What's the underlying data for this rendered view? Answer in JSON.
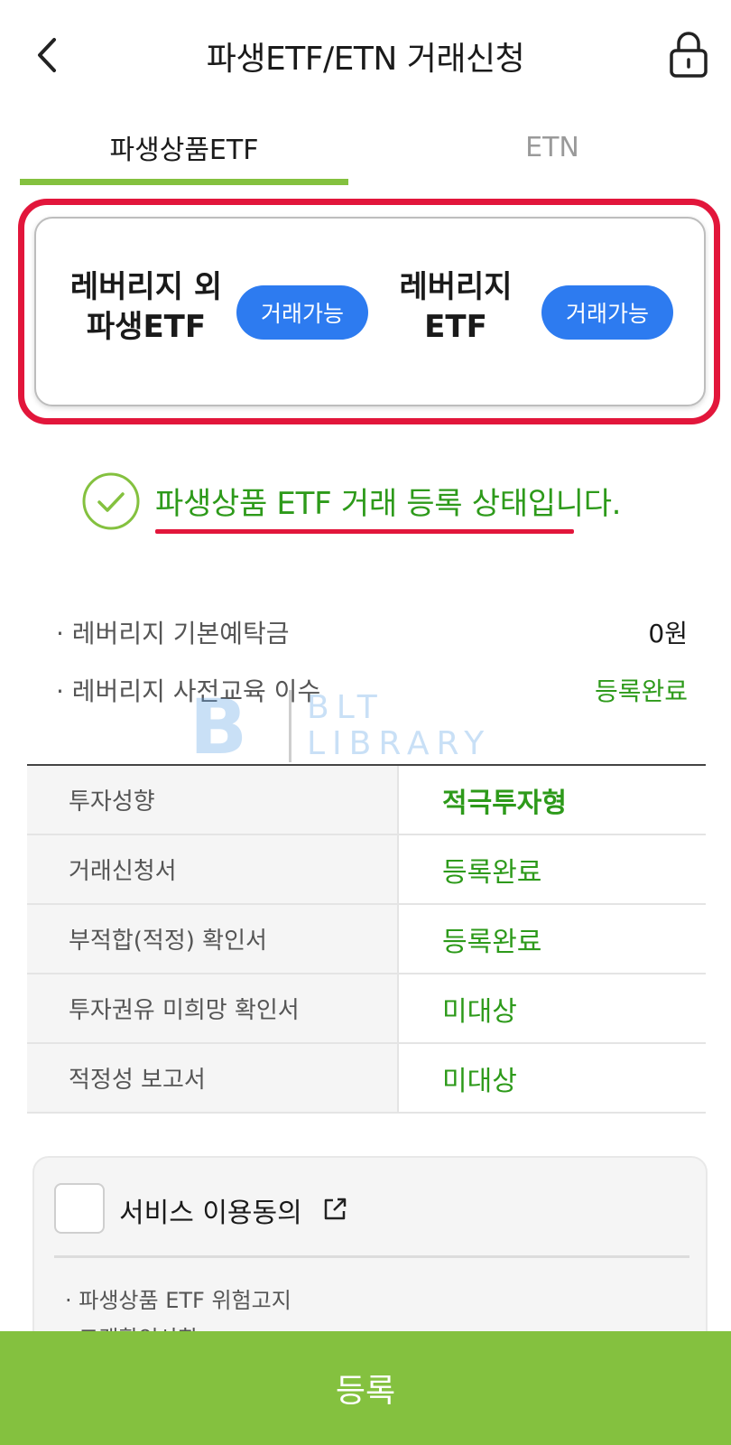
{
  "header": {
    "title": "파생ETF/ETN 거래신청",
    "back_icon": "chevron-left-icon",
    "lock_icon": "lock-icon"
  },
  "tabs": [
    {
      "label": "파생상품ETF",
      "active": true
    },
    {
      "label": "ETN",
      "active": false
    }
  ],
  "status_card": {
    "items": [
      {
        "label": "레버리지 외\n파생ETF",
        "status": "거래가능"
      },
      {
        "label": "레버리지\nETF",
        "status": "거래가능"
      }
    ]
  },
  "status_message": "파생상품 ETF 거래 등록 상태입니다.",
  "info": {
    "deposit_label": "· 레버리지 기본예탁금",
    "deposit_value": "0원",
    "education_label": "· 레버리지 사전교육 이수",
    "education_value": "등록완료"
  },
  "watermark": {
    "letter": "B",
    "line1": "BLT",
    "line2": "LIBRARY"
  },
  "documents": [
    {
      "label": "투자성향",
      "value": "적극투자형"
    },
    {
      "label": "거래신청서",
      "value": "등록완료"
    },
    {
      "label": "부적합(적정) 확인서",
      "value": "등록완료"
    },
    {
      "label": "투자권유 미희망 확인서",
      "value": "미대상"
    },
    {
      "label": "적정성 보고서",
      "value": "미대상"
    }
  ],
  "agreement": {
    "title": "서비스 이용동의",
    "items": [
      "· 파생상품 ETF 위험고지",
      "· 고객확인사항"
    ]
  },
  "register_button": "등록",
  "colors": {
    "accent_green": "#84c13f",
    "status_green": "#2d9a1a",
    "pill_blue": "#2d7bf0",
    "highlight_red": "#e2163b"
  }
}
